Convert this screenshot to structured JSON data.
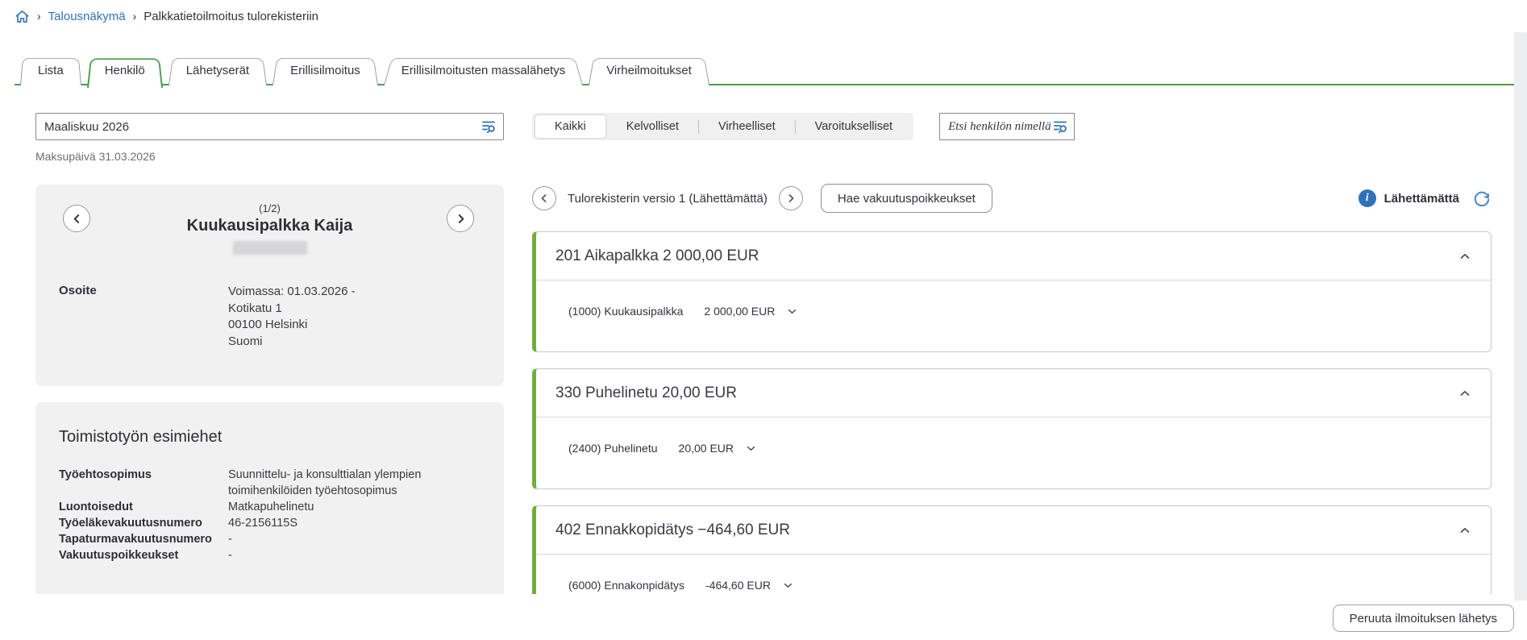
{
  "colors": {
    "accent_green": "#4e9b50",
    "card_accent_green": "#6fae3e",
    "link_blue": "#2f72b8"
  },
  "breadcrumb": {
    "separator": "›",
    "home_icon": "home-icon",
    "link": "Talousnäkymä",
    "current": "Palkkatietoilmoitus tulorekisteriin"
  },
  "tabs": [
    {
      "label": "Lista",
      "active": false
    },
    {
      "label": "Henkilö",
      "active": true
    },
    {
      "label": "Lähetyserät",
      "active": false
    },
    {
      "label": "Erillisilmoitus",
      "active": false
    },
    {
      "label": "Erillisilmoitusten massalähetys",
      "active": false
    },
    {
      "label": "Virheilmoitukset",
      "active": false
    }
  ],
  "left": {
    "period_value": "Maaliskuu 2026",
    "period_icon": "list-search-icon",
    "payday_text": "Maksupäivä 31.03.2026",
    "person": {
      "pager": "(1/2)",
      "name": "Kuukausipalkka Kaija",
      "address_label": "Osoite",
      "address_lines": {
        "0": "Voimassa: 01.03.2026 -",
        "1": "Kotikatu 1",
        "2": "00100 Helsinki",
        "3": "Suomi"
      }
    },
    "employment": {
      "title": "Toimistotyön esimiehet",
      "rows": [
        {
          "label": "Työehtosopimus",
          "value": "Suunnittelu- ja konsulttialan ylempien toimihenkilöiden työehtosopimus"
        },
        {
          "label": "Luontoisedut",
          "value": "Matkapuhelinetu"
        },
        {
          "label": "Työeläkevakuutusnumero",
          "value": "46-2156115S"
        },
        {
          "label": "Tapaturmavakuutusnumero",
          "value": "-"
        },
        {
          "label": "Vakuutuspoikkeukset",
          "value": "-"
        }
      ]
    }
  },
  "right": {
    "filters": [
      {
        "label": "Kaikki",
        "active": true
      },
      {
        "label": "Kelvolliset",
        "active": false
      },
      {
        "label": "Virheelliset",
        "active": false
      },
      {
        "label": "Varoitukselliset",
        "active": false
      }
    ],
    "search_placeholder": "Etsi henkilön nimellä",
    "version_text": "Tulorekisterin versio 1 (Lähettämättä)",
    "insurance_button": "Hae vakuutuspoikkeukset",
    "status_label": "Lähettämättä",
    "income_cards": [
      {
        "title": "201 Aikapalkka 2 000,00 EUR",
        "row": {
          "code_name": "(1000) Kuukausipalkka",
          "amount": "2 000,00 EUR"
        }
      },
      {
        "title": "330 Puhelinetu 20,00 EUR",
        "row": {
          "code_name": "(2400) Puhelinetu",
          "amount": "20,00 EUR"
        }
      },
      {
        "title": "402 Ennakkopidätys −464,60 EUR",
        "row": {
          "code_name": "(6000) Ennakonpidätys",
          "amount": "-464,60 EUR"
        }
      }
    ]
  },
  "footer": {
    "cancel_button": "Peruuta ilmoituksen lähetys"
  }
}
